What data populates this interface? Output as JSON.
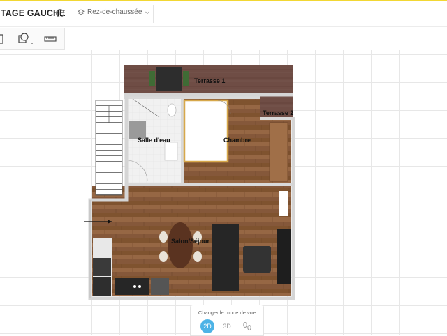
{
  "header": {
    "title": "TAGE GAUCHE",
    "floor_selector": "Rez-de-chaussée"
  },
  "icons": {
    "info": "info-icon",
    "layers": "layers-icon",
    "chevron": "chevron-down-icon",
    "shape": "shape-tool-icon",
    "ruler": "ruler-icon"
  },
  "rooms": {
    "terrasse1": "Terrasse 1",
    "terrasse2": "Terrasse 2",
    "salle_eau": "Salle d'eau",
    "chambre": "Chambre",
    "salon": "Salon/Séjour"
  },
  "view_mode": {
    "label": "Changer le mode de vue",
    "option_2d": "2D",
    "option_3d": "3D",
    "active": "2D"
  },
  "colors": {
    "accent": "#4db3e6",
    "top_bar": "#f2d733",
    "floor_wood": "#8a5a35",
    "terrace": "#6e4c44",
    "wall": "#d9d9d9"
  }
}
